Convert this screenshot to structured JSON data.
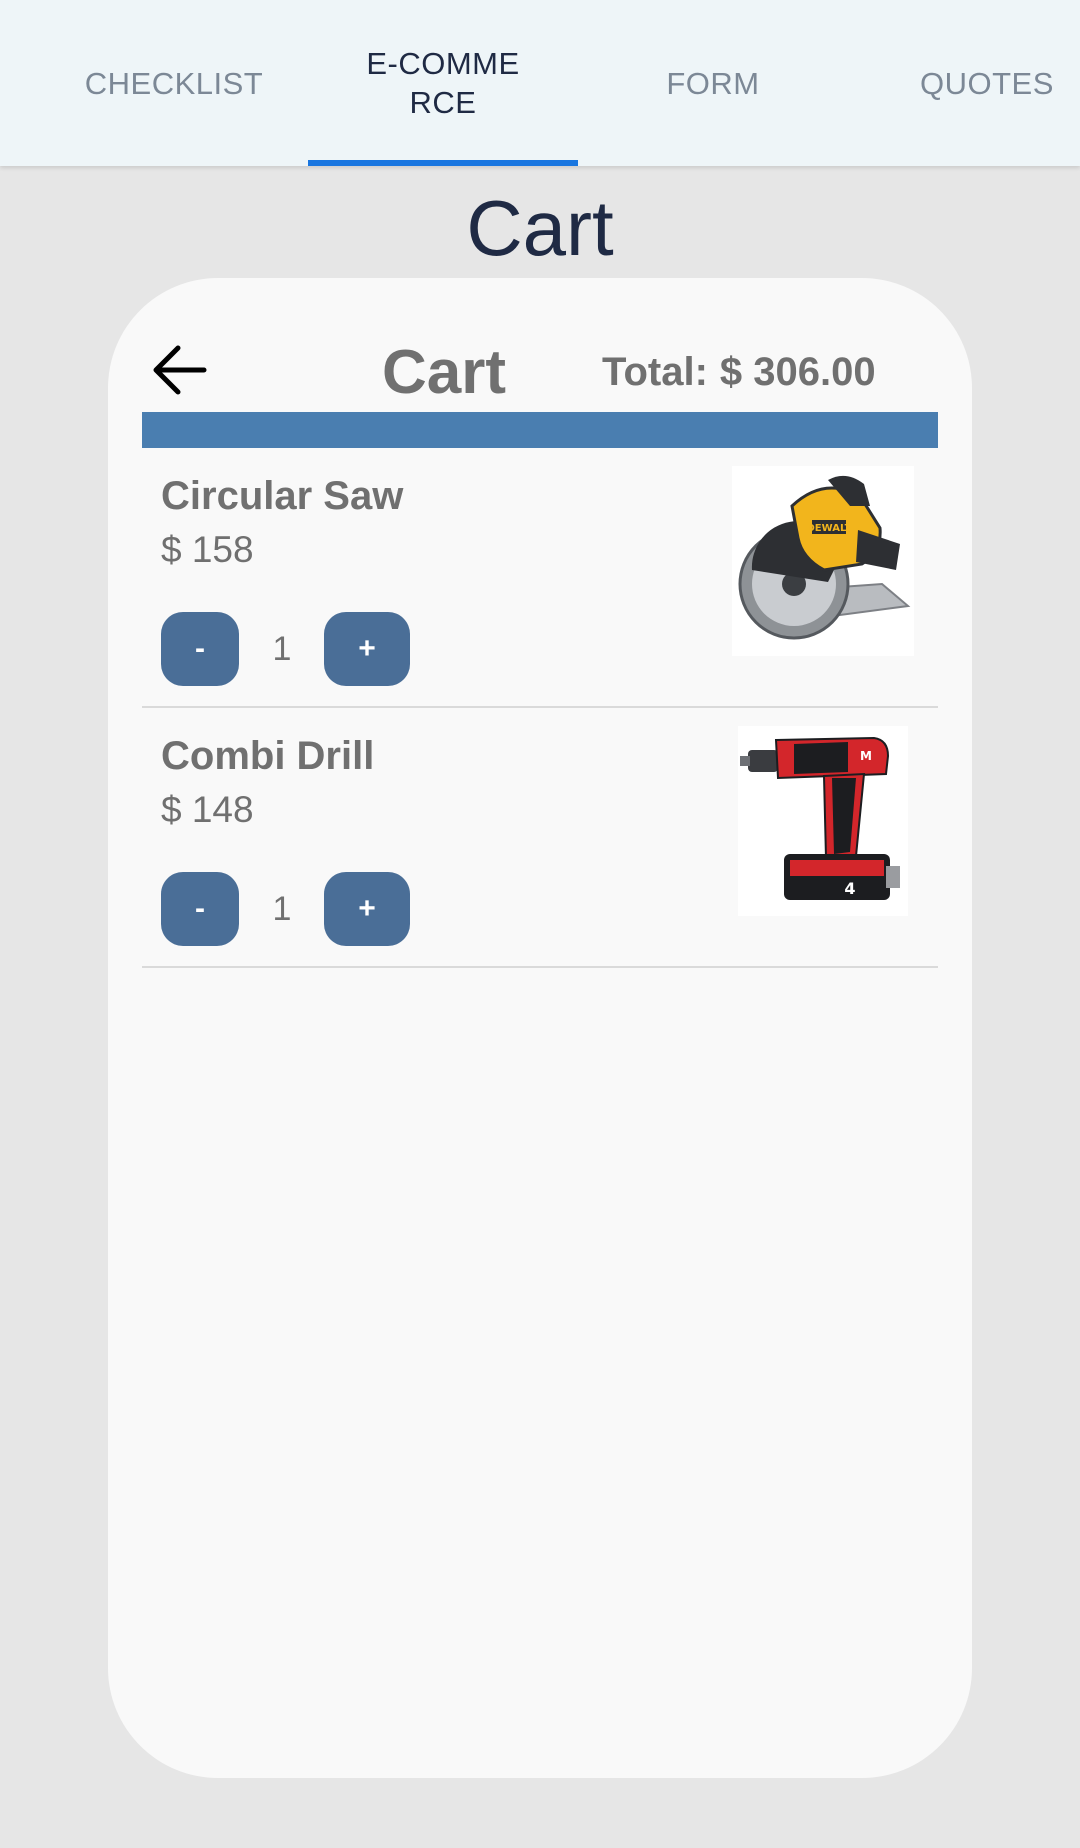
{
  "tabs": [
    {
      "label": "CHECKLIST",
      "active": false
    },
    {
      "label": "E-COMMERCE",
      "active": true
    },
    {
      "label": "FORM",
      "active": false
    },
    {
      "label": "QUOTES",
      "active": false
    }
  ],
  "page_title": "Cart",
  "cart": {
    "title": "Cart",
    "total_label": "Total:",
    "total_value": "$ 306.00",
    "back_icon": "arrow-left-icon",
    "header_bar_color": "#4a7eb0",
    "button_color": "#4a6e97",
    "items": [
      {
        "name": "Circular Saw",
        "price": "$ 158",
        "quantity": "1",
        "minus_label": "-",
        "plus_label": "+",
        "image_icon": "circular-saw-image"
      },
      {
        "name": "Combi Drill",
        "price": "$ 148",
        "quantity": "1",
        "minus_label": "-",
        "plus_label": "+",
        "image_icon": "combi-drill-image"
      }
    ]
  },
  "colors": {
    "tab_active_indicator": "#1976e0",
    "tab_bar_bg": "#eef5f8",
    "page_bg": "#e6e6e6",
    "card_bg": "#f9f9f9"
  }
}
